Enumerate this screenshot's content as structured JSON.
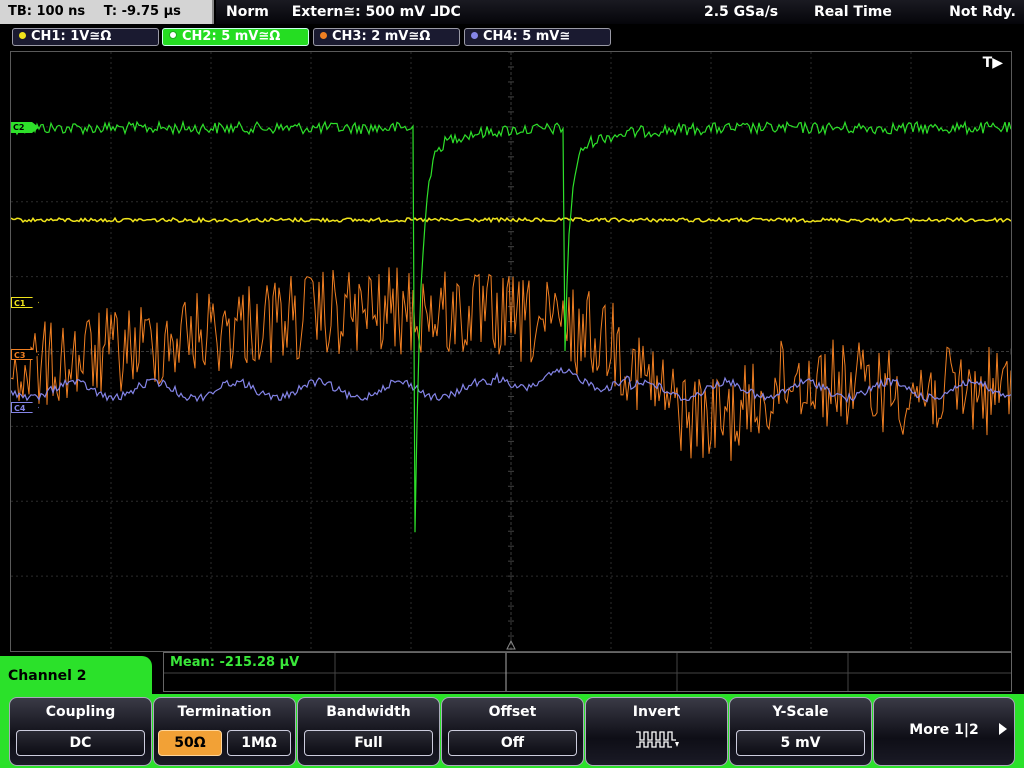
{
  "status": {
    "timebase": "TB: 100 ns",
    "trigger_time": "T: -9.75 µs",
    "mode": "Norm",
    "trigger_source": "Extern≅: 500 mV ⅃DC",
    "sample_rate": "2.5 GSa/s",
    "acquisition": "Real Time",
    "ready_state": "Not Rdy."
  },
  "channels": [
    {
      "label": "CH1: 1V≅Ω",
      "color": "#f0e41c",
      "active": false
    },
    {
      "label": "CH2: 5 mV≅Ω",
      "color": "#2ee02a",
      "active": true
    },
    {
      "label": "CH3: 2 mV≅Ω",
      "color": "#f07f22",
      "active": false
    },
    {
      "label": "CH4: 5 mV≅",
      "color": "#8585e8",
      "active": false
    }
  ],
  "screen": {
    "trigger_marker": "T▶",
    "markers": [
      {
        "label": "C2",
        "color": "#2ee02a"
      },
      {
        "label": "C1",
        "color": "#f0e41c"
      },
      {
        "label": "C3",
        "color": "#f07f22"
      },
      {
        "label": "C4",
        "color": "#8585e8"
      }
    ]
  },
  "measurement": {
    "mean": "Mean: -215.28 µV"
  },
  "menu": {
    "title": "Channel 2",
    "softkeys": {
      "coupling": {
        "title": "Coupling",
        "value": "DC"
      },
      "termination": {
        "title": "Termination",
        "option_a": "50Ω",
        "option_b": "1MΩ",
        "selected": "50Ω"
      },
      "bandwidth": {
        "title": "Bandwidth",
        "value": "Full"
      },
      "offset": {
        "title": "Offset",
        "value": "Off"
      },
      "invert": {
        "title": "Invert",
        "icon": "invert-waveform-icon"
      },
      "yscale": {
        "title": "Y-Scale",
        "value": "5 mV"
      },
      "more": {
        "label": "More 1|2",
        "icon": "arrow-right-icon"
      }
    }
  }
}
